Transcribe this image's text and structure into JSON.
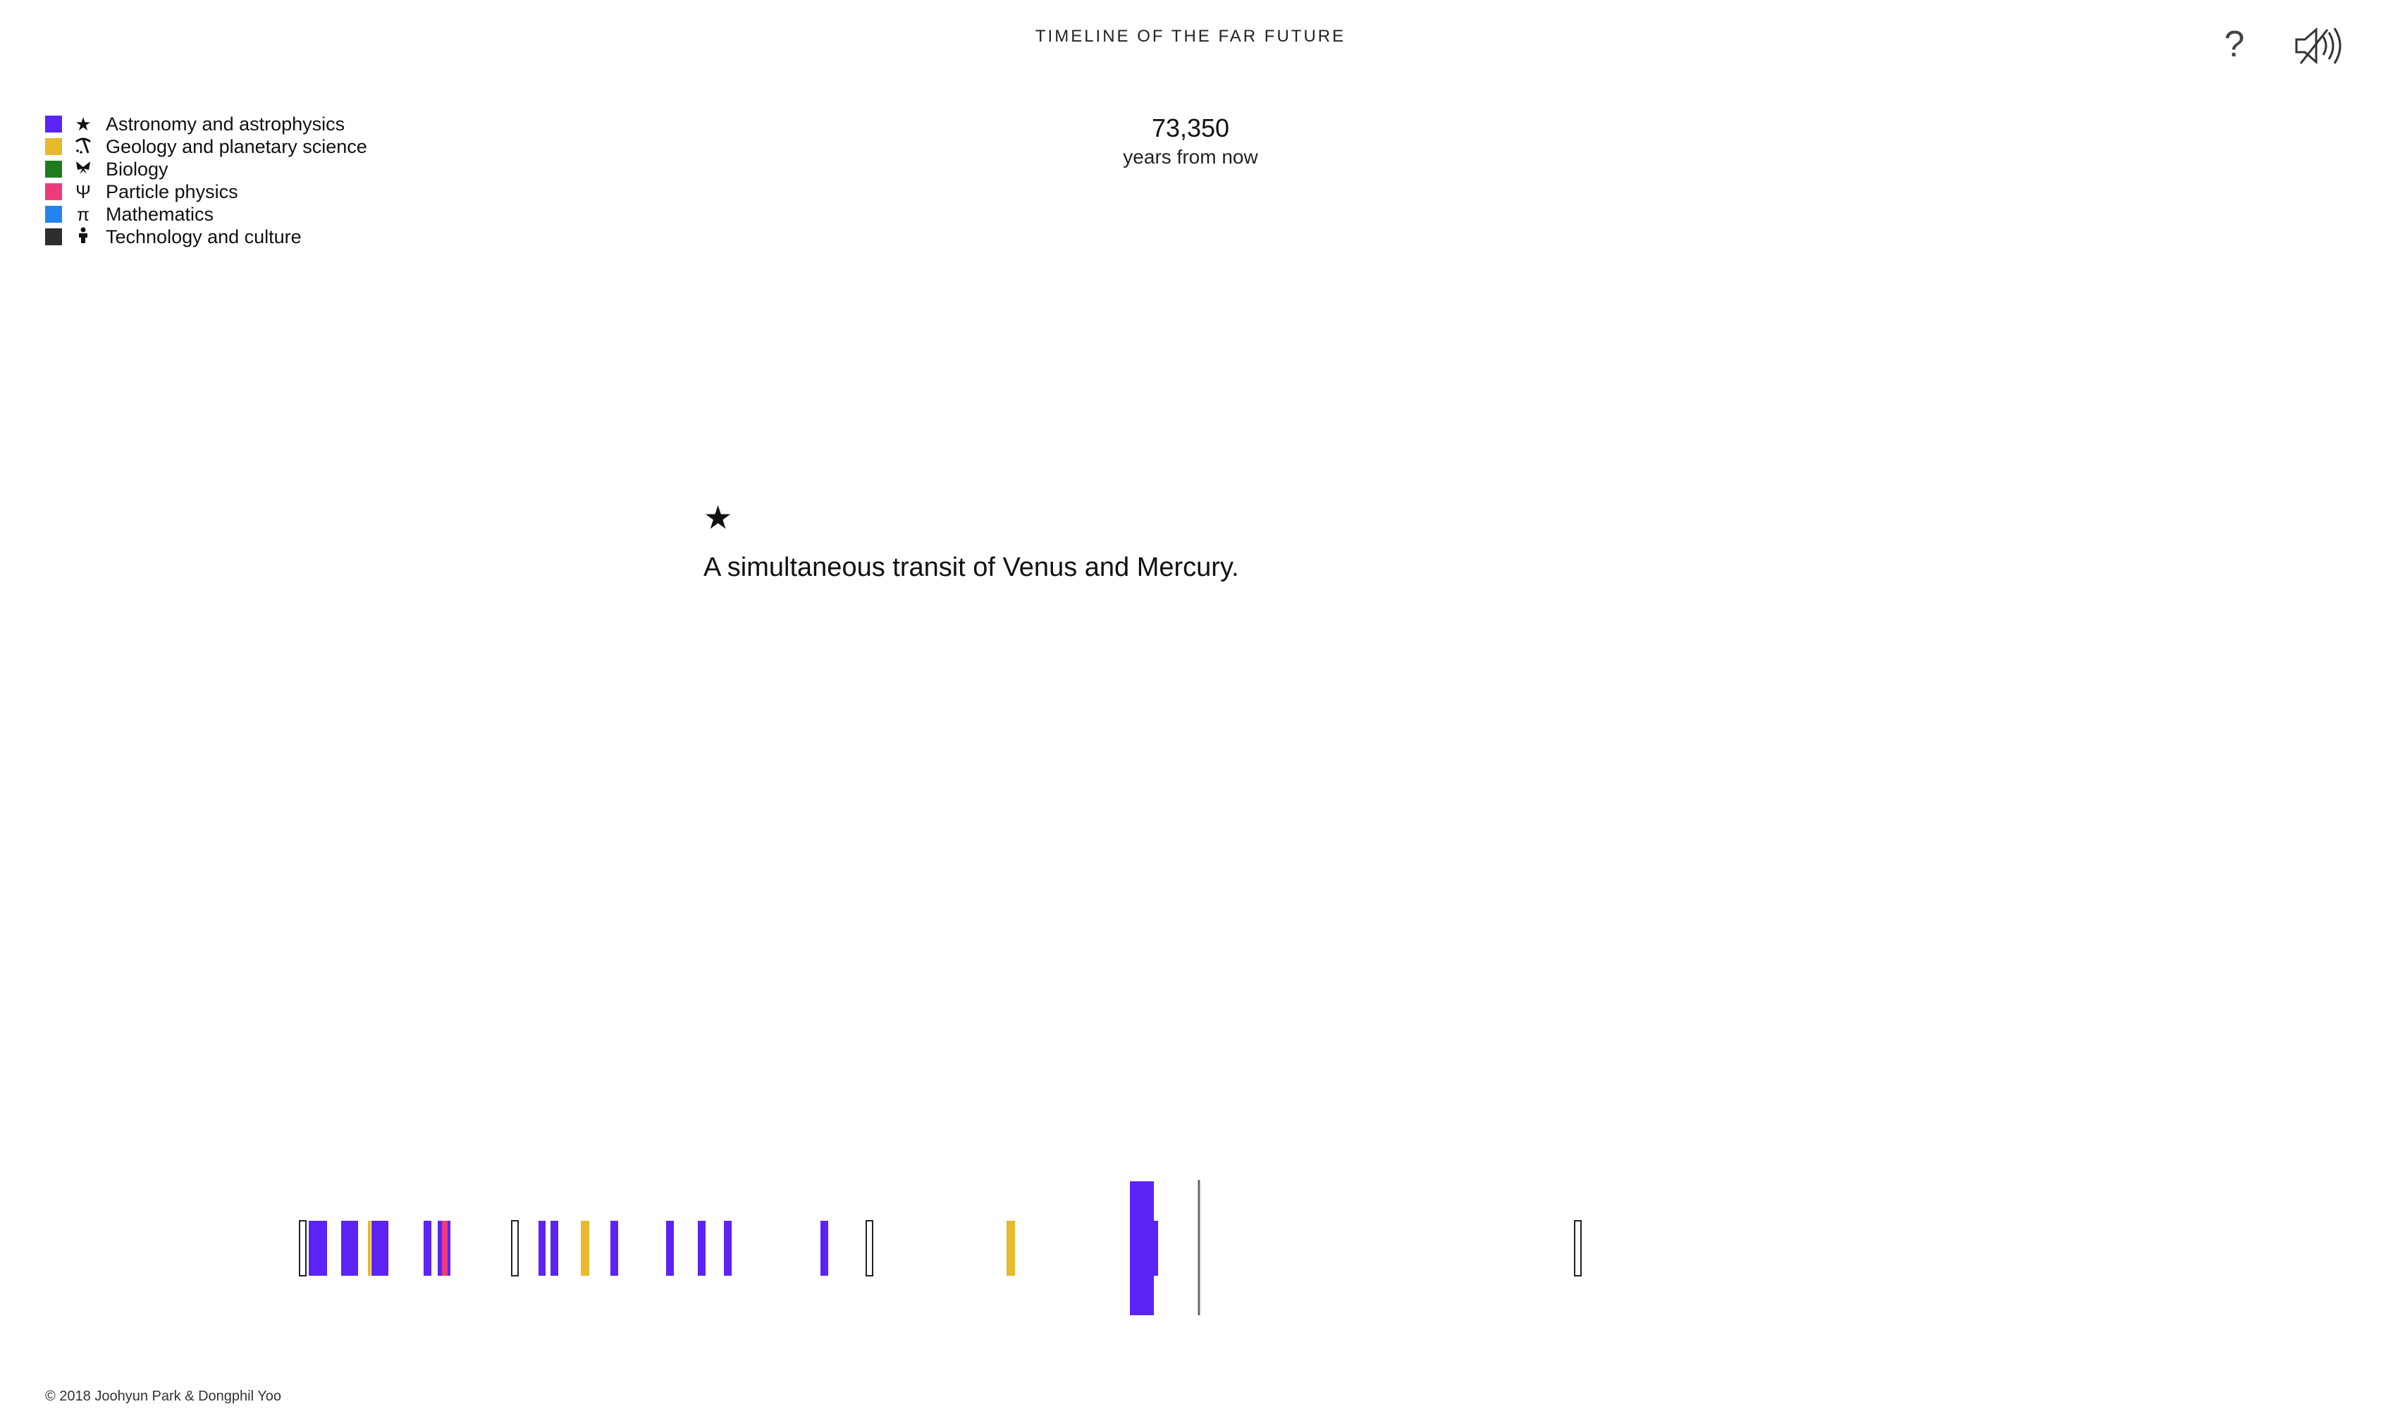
{
  "header": {
    "title": "TIMELINE OF THE FAR FUTURE",
    "help_label": "?"
  },
  "legend": {
    "items": [
      {
        "label": "Astronomy and astrophysics",
        "icon": "star-icon",
        "glyph": "★",
        "color": "#5b24f5"
      },
      {
        "label": "Geology and planetary science",
        "icon": "pickaxe-icon",
        "glyph": "⛏",
        "color": "#e8b92c"
      },
      {
        "label": "Biology",
        "icon": "butterfly-icon",
        "glyph": "Ƹ̵̡Ӝ̵̨̄Ʒ",
        "color": "#1e7c1e"
      },
      {
        "label": "Particle physics",
        "icon": "psi-icon",
        "glyph": "Ψ",
        "color": "#ee3a7a"
      },
      {
        "label": "Mathematics",
        "icon": "pi-icon",
        "glyph": "π",
        "color": "#2384ef"
      },
      {
        "label": "Technology and culture",
        "icon": "person-icon",
        "glyph": "♟",
        "color": "#2e2e2e"
      }
    ]
  },
  "current": {
    "year_value": "73,350",
    "year_unit": "years from now"
  },
  "event": {
    "icon": "star-icon",
    "glyph": "★",
    "text": "A simultaneous transit of Venus and Mercury."
  },
  "timeline": {
    "colors": {
      "astronomy": "#5b24f5",
      "geology": "#e8b92c",
      "particle": "#ee3a7a",
      "cursor": "#666666"
    }
  },
  "footer": {
    "text": "© 2018 Joohyun Park & Dongphil Yoo"
  }
}
